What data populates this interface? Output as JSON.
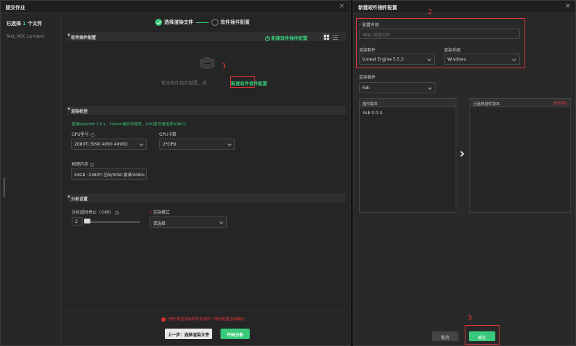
{
  "left_window": {
    "title": "提交作业",
    "close": "×",
    "sidebar": {
      "selected_prefix": "已选择 ",
      "selected_count": "1",
      "selected_suffix": " 个文件",
      "project": "Test_MSC.uproject"
    },
    "steps": [
      {
        "label": "选择渲染文件",
        "state": "done"
      },
      {
        "label": "软件插件配置",
        "state": "todo"
      }
    ],
    "software_section": {
      "title": "软件插件配置",
      "add_button": "新建软件插件配置",
      "empty_text": "暂无软件插件配置，请",
      "empty_link": "新建软件插件配置"
    },
    "render_section": {
      "title": "渲染机型",
      "hint": "使用Redshift 2.5 x、Fstorm插件时任务，GPU型号请选择1080Ti",
      "gpu_model_label": "GPU型号",
      "gpu_model_value": "2080Ti 3090 4090 4090D",
      "gpu_count_label": "GPU卡数",
      "gpu_count_value": "2*GPU",
      "memory_label": "物理内存",
      "memory_value": "64GB（2080Ti 空闲/3090 繁满/4090c"
    },
    "analysis_section": {
      "title": "分析设置",
      "timeout_label": "分析超时停止（小时）",
      "timeout_value": "2",
      "timeout_fraction": 0.05,
      "mode_label": "渲染模式",
      "mode_placeholder": "请选择"
    },
    "footer": {
      "warning": "*请先配置渲染软件及插件 *请先配置渲染模式",
      "prev_button": "上一步：选择渲染文件",
      "start_button": "开始分析"
    }
  },
  "right_window": {
    "title": "新建软件插件配置",
    "close": "×",
    "config_name_label": "配置名称",
    "config_name_placeholder": "请输入配置名称",
    "software_label": "渲染软件",
    "software_value": "Unreal Engine 5.5.3",
    "os_label": "渲染系统",
    "os_value": "Windows",
    "plugin_label": "渲染插件",
    "plugin_value": "Fab",
    "versions_header": "插件版本",
    "versions": [
      "Fab 0.0.3"
    ],
    "selected_header": "已选择插件版本",
    "clear_all": "全部清除",
    "cancel_button": "取消",
    "ok_button": "确定"
  },
  "annotations": [
    "1",
    "2",
    "3"
  ],
  "colors": {
    "accent": "#38c97a",
    "alert": "#e03535",
    "bg": "#252526"
  }
}
